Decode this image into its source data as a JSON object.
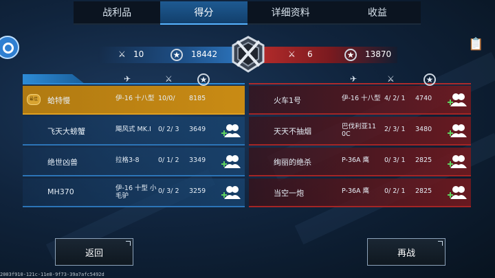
{
  "tabs": [
    {
      "label": "战利品"
    },
    {
      "label": "得分",
      "active": true
    },
    {
      "label": "详细资料"
    },
    {
      "label": "收益"
    }
  ],
  "team_blue": {
    "kills": "10",
    "score": "18442"
  },
  "team_red": {
    "kills": "6",
    "score": "13870"
  },
  "blue_rows": [
    {
      "name": "蛤特慢",
      "plane": "伊-16 十八型",
      "kd": "10/0/",
      "score": "8185",
      "me": true,
      "badge": "最佳"
    },
    {
      "name": "飞天大螃蟹",
      "plane": "飓风式 MK.I",
      "kd": "0/ 2/ 3",
      "score": "3649"
    },
    {
      "name": "绝世凶兽",
      "plane": "拉格3-8",
      "kd": "0/ 1/ 2",
      "score": "3349"
    },
    {
      "name": "MH370",
      "plane": "伊-16 十型 小毛驴",
      "kd": "0/ 3/ 2",
      "score": "3259"
    }
  ],
  "red_rows": [
    {
      "name": "火车1号",
      "plane": "伊-16 十八型",
      "kd": "4/ 2/ 1",
      "score": "4740"
    },
    {
      "name": "天天不抽烟",
      "plane": "巴伐利亚11 0C",
      "kd": "2/ 3/ 1",
      "score": "3480"
    },
    {
      "name": "绚丽的绝杀",
      "plane": "P-36A 鹰",
      "kd": "0/ 3/ 1",
      "score": "2825"
    },
    {
      "name": "当空一炮",
      "plane": "P-36A 鹰",
      "kd": "0/ 2/ 1",
      "score": "2825"
    }
  ],
  "buttons": {
    "back": "返回",
    "again": "再战"
  },
  "footer_id": "2003f910-121c-11e8-9f73-39a7afc5492d",
  "colors": {
    "blue": "#2d8bd6",
    "red": "#b02a2a",
    "gold": "#c98b14"
  }
}
